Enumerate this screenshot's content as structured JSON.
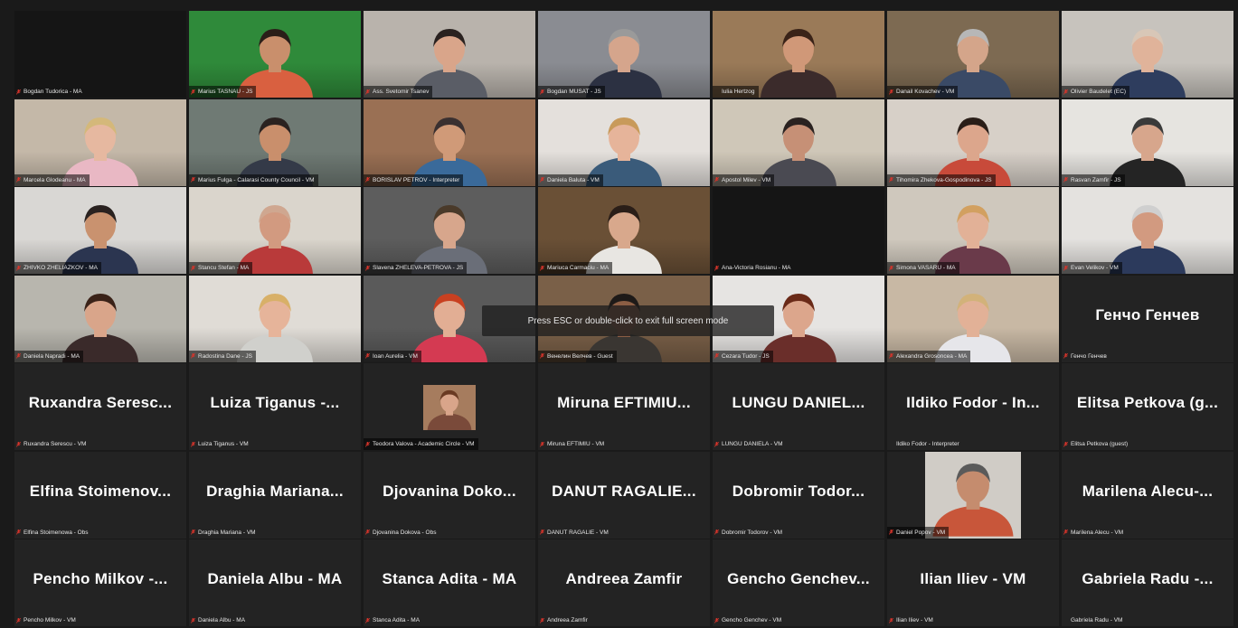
{
  "app": {
    "fullscreen_hint": "Press ESC or double-click to exit full screen mode"
  },
  "colors": {
    "muted_mic": "#d9342b",
    "active_speaker": "#c9d23a",
    "tile_bg": "#232323"
  },
  "participants": [
    {
      "label": "Bogdan Tudorica - MA",
      "type": "blank",
      "bg": "#151515",
      "muted": true
    },
    {
      "label": "Marius TASNAU - JS",
      "type": "video",
      "bg": "#2f8a3a",
      "shirt": "#d96040",
      "skin": "#c98f6c",
      "hair": "#2a1e18",
      "muted": true
    },
    {
      "label": "Ass. Svetomir Tsanev",
      "type": "video",
      "bg": "#b9b3ac",
      "shirt": "#5a5d66",
      "skin": "#d9a58a",
      "hair": "#2a2220",
      "muted": true
    },
    {
      "label": "Bogdan MUSAT - JS",
      "type": "video",
      "bg": "#8a8c92",
      "shirt": "#2c3142",
      "skin": "#d5a58c",
      "hair": "#9a9a9a",
      "muted": true
    },
    {
      "label": "Iulia Hertzog",
      "type": "video",
      "bg": "#9a7a58",
      "shirt": "#3b2b2b",
      "skin": "#d09878",
      "hair": "#3a2318",
      "muted": false,
      "active": true
    },
    {
      "label": "Danail Kovachev - VM",
      "type": "video",
      "bg": "#7d6a52",
      "shirt": "#3a4a66",
      "skin": "#d4a58a",
      "hair": "#b7b7b7",
      "muted": true
    },
    {
      "label": "Olivier Baudelet (EC)",
      "type": "video",
      "bg": "#c7c3bd",
      "shirt": "#2e3d5e",
      "skin": "#e0b39a",
      "hair": "#d8c7b7",
      "muted": true
    },
    {
      "label": "Marcela Glodeanu - MA",
      "type": "video",
      "bg": "#c4b8a8",
      "shirt": "#e9b8c4",
      "skin": "#e6b8a0",
      "hair": "#d4b87a",
      "muted": true
    },
    {
      "label": "Marius Fulga - Calarasi County Council - VM",
      "type": "video",
      "bg": "#6f7a74",
      "shirt": "#343a48",
      "skin": "#c98f6c",
      "hair": "#2a2220",
      "muted": true
    },
    {
      "label": "BORISLAV PETROV - Interpreter",
      "type": "video",
      "bg": "#9a7054",
      "shirt": "#3a6a9a",
      "skin": "#d09a78",
      "hair": "#3a3030",
      "muted": true
    },
    {
      "label": "Daniela Baluta - VM",
      "type": "video",
      "bg": "#e4e0dc",
      "shirt": "#3a5b7a",
      "skin": "#e6b49a",
      "hair": "#c89a5a",
      "muted": true
    },
    {
      "label": "Apostol Milev - VM",
      "type": "video",
      "bg": "#cfc7b8",
      "shirt": "#4a4a52",
      "skin": "#c69076",
      "hair": "#2a2220",
      "muted": true
    },
    {
      "label": "Tihomira Zhekova-Gospodinova - JS",
      "type": "video",
      "bg": "#d7d0c8",
      "shirt": "#c84a3a",
      "skin": "#dca68c",
      "hair": "#2a1e18",
      "muted": true
    },
    {
      "label": "Rasvan Zamfir - JS",
      "type": "video",
      "bg": "#e6e4e0",
      "shirt": "#242424",
      "skin": "#d7a68c",
      "hair": "#3a3a3a",
      "muted": true
    },
    {
      "label": "ZHIVKO ZHELIAZKOV - MA",
      "type": "video",
      "bg": "#d9d7d4",
      "shirt": "#2b3550",
      "skin": "#c9926f",
      "hair": "#2a2220",
      "muted": true
    },
    {
      "label": "Stancu Stefan - MA",
      "type": "video",
      "bg": "#dad5cc",
      "shirt": "#b93a3a",
      "skin": "#d29a80",
      "hair": "#cfa790",
      "muted": true
    },
    {
      "label": "Slavena ZHELEVA-PETROVA - JS",
      "type": "video",
      "bg": "#5d5d5d",
      "shirt": "#6a6e78",
      "skin": "#d7a68c",
      "hair": "#4a3a2a",
      "muted": true
    },
    {
      "label": "Mariuca Carmaciu - MA",
      "type": "video",
      "bg": "#6a5036",
      "shirt": "#e8e6e2",
      "skin": "#d8a88c",
      "hair": "#2a1e18",
      "muted": true
    },
    {
      "label": "Ana-Victoria Rosianu - MA",
      "type": "blank",
      "bg": "#151515",
      "muted": true
    },
    {
      "label": "Simona VASARU - MA",
      "type": "video",
      "bg": "#cfc8bd",
      "shirt": "#6a3a4a",
      "skin": "#e2b197",
      "hair": "#d2a060",
      "muted": true
    },
    {
      "label": "Evan Velikov - VM",
      "type": "video",
      "bg": "#e4e2df",
      "shirt": "#2c3a5c",
      "skin": "#d29a80",
      "hair": "#cfcfcf",
      "muted": true
    },
    {
      "label": "Daniela Napradi - MA",
      "type": "video",
      "bg": "#b8b6ae",
      "shirt": "#3a2a2a",
      "skin": "#d9a58a",
      "hair": "#3a2218",
      "muted": true
    },
    {
      "label": "Radostina Dane - JS",
      "type": "video",
      "bg": "#e0dcd6",
      "shirt": "#d0d0cc",
      "skin": "#e6b49a",
      "hair": "#d8b068",
      "muted": true
    },
    {
      "label": "Ioan Aurelia - VM",
      "type": "video",
      "bg": "#5a5a5a",
      "shirt": "#d43a52",
      "skin": "#e2ae94",
      "hair": "#c84020",
      "muted": true
    },
    {
      "label": "Венелин Велчев - Guest",
      "type": "video",
      "bg": "#7a6048",
      "shirt": "#3a3632",
      "skin": "#8c5e44",
      "hair": "#1e1a18",
      "muted": true
    },
    {
      "label": "Cezara Tudor - JS",
      "type": "video",
      "bg": "#e6e4e2",
      "shirt": "#6a2e2a",
      "skin": "#dca68c",
      "hair": "#6a2a18",
      "muted": true
    },
    {
      "label": "Alexandra Grosoncea - MA",
      "type": "video",
      "bg": "#c8b8a4",
      "shirt": "#e6e6ea",
      "skin": "#e2b197",
      "hair": "#d2b27a",
      "muted": true
    },
    {
      "label": "Генчо Генчев",
      "type": "text",
      "big": "Генчо Генчев",
      "muted": true
    },
    {
      "label": "Ruxandra Serescu - VM",
      "type": "text",
      "big": "Ruxandra Seresc...",
      "muted": true
    },
    {
      "label": "Luiza Tiganus - VM",
      "type": "text",
      "big": "Luiza Tiganus -...",
      "muted": true
    },
    {
      "label": "Teodora Valova - Academic Circle - VM",
      "type": "avatar",
      "bg": "#a67c5e",
      "shirt": "#7a4a3a",
      "skin": "#d9a58a",
      "hair": "#6a3a22",
      "muted": true
    },
    {
      "label": "Miruna EFTIMIU - VM",
      "type": "text",
      "big": "Miruna EFTIMIU...",
      "muted": true
    },
    {
      "label": "LUNGU DANIELA - VM",
      "type": "text",
      "big": "LUNGU DANIEL...",
      "muted": true
    },
    {
      "label": "Ildiko Fodor - Interpreter",
      "type": "text",
      "big": "Ildiko Fodor - In...",
      "muted": false
    },
    {
      "label": "Elitsa Petkova (guest)",
      "type": "text",
      "big": "Elitsa Petkova (g...",
      "muted": true
    },
    {
      "label": "Elfina Stoimenowa - Obs",
      "type": "text",
      "big": "Elfina Stoimenov...",
      "muted": true
    },
    {
      "label": "Draghia Mariana - VM",
      "type": "text",
      "big": "Draghia Mariana...",
      "muted": true
    },
    {
      "label": "Djovanina Dokova - Obs",
      "type": "text",
      "big": "Djovanina Doko...",
      "muted": true
    },
    {
      "label": "DANUT RAGALIE - VM",
      "type": "text",
      "big": "DANUT RAGALIE...",
      "muted": true
    },
    {
      "label": "Dobromir Todorov - VM",
      "type": "text",
      "big": "Dobromir Todor...",
      "muted": true
    },
    {
      "label": "Daniel Popov - VM",
      "type": "avatar-large",
      "bg": "#d0ccc6",
      "shirt": "#c8563a",
      "skin": "#c58c6e",
      "hair": "#5a5a5a",
      "muted": true
    },
    {
      "label": "Marilena Alecu - VM",
      "type": "text",
      "big": "Marilena Alecu-...",
      "muted": true
    },
    {
      "label": "Pencho Milkov - VM",
      "type": "text",
      "big": "Pencho Milkov -...",
      "muted": true
    },
    {
      "label": "Daniela Albu - MA",
      "type": "text",
      "big": "Daniela Albu - MA",
      "muted": true
    },
    {
      "label": "Stanca Adita - MA",
      "type": "text",
      "big": "Stanca Adita - MA",
      "muted": true
    },
    {
      "label": "Andreea Zamfir",
      "type": "text",
      "big": "Andreea Zamfir",
      "muted": true
    },
    {
      "label": "Gencho Genchev - VM",
      "type": "text",
      "big": "Gencho Genchev...",
      "muted": true
    },
    {
      "label": "Ilian Iliev - VM",
      "type": "text",
      "big": "Ilian Iliev - VM",
      "muted": true
    },
    {
      "label": "Gabriela Radu - VM",
      "type": "text",
      "big": "Gabriela Radu -...",
      "muted": false
    }
  ]
}
